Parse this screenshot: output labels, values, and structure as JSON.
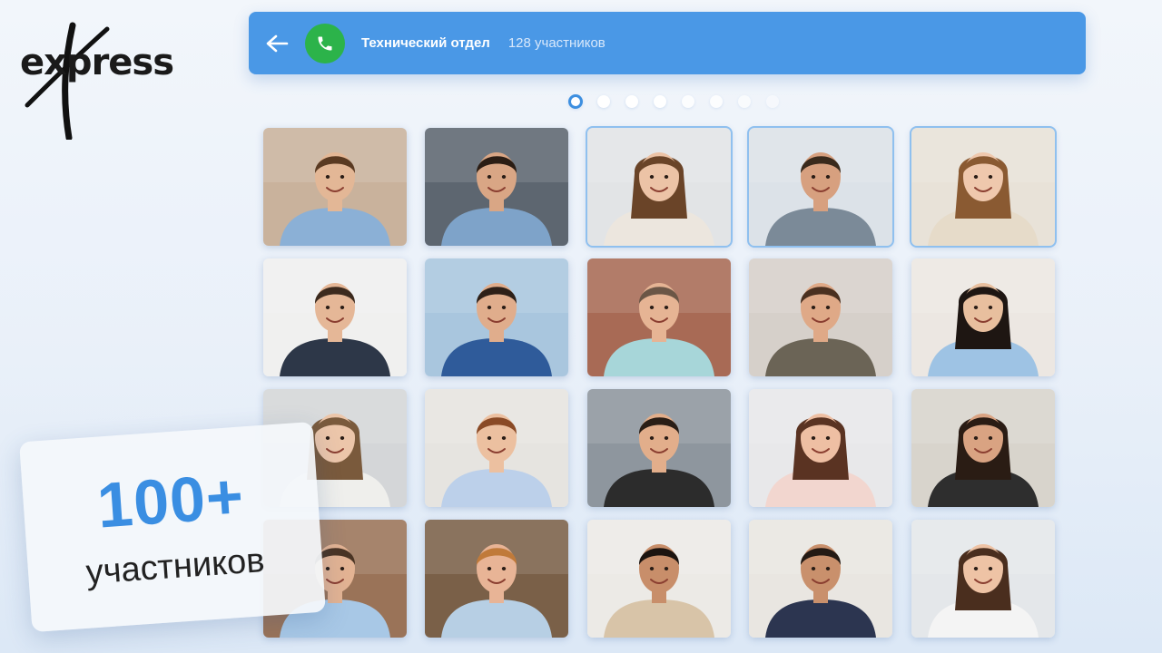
{
  "app": {
    "logo_text": "express"
  },
  "header": {
    "back_icon": "arrow-left-icon",
    "call_icon": "phone-icon",
    "title": "Технический отдел",
    "participants": "128 участников",
    "colors": {
      "bar": "#4a98e6",
      "call": "#2cb34a"
    }
  },
  "pagination": {
    "pages": 8,
    "current": 1
  },
  "participants_grid": {
    "tiles": [
      {
        "bg": "#c9b29c",
        "skin": "#e3b796",
        "hair": "#5a3a22",
        "shirt": "#8bb0d6"
      },
      {
        "bg": "#5d6670",
        "skin": "#d9a685",
        "hair": "#2b1d14",
        "shirt": "#7ea3c9"
      },
      {
        "bg": "#e2e4e6",
        "skin": "#ecc3a6",
        "hair": "#6a4428",
        "shirt": "#ece6de"
      },
      {
        "bg": "#dce2e8",
        "skin": "#d7a07f",
        "hair": "#3a2a1c",
        "shirt": "#7b8a98"
      },
      {
        "bg": "#e8e2d8",
        "skin": "#efc8ad",
        "hair": "#8a5a32",
        "shirt": "#e6dbc9"
      },
      {
        "bg": "#f0f0ef",
        "skin": "#e5b797",
        "hair": "#3c2a1e",
        "shirt": "#2d3748"
      },
      {
        "bg": "#a9c6de",
        "skin": "#e0ad8c",
        "hair": "#2e2018",
        "shirt": "#2f5b9a"
      },
      {
        "bg": "#a86a55",
        "skin": "#e6b494",
        "hair": "#6b5646",
        "shirt": "#a7d6d9"
      },
      {
        "bg": "#d6d0ca",
        "skin": "#dfa987",
        "hair": "#4a3020",
        "shirt": "#6b6456"
      },
      {
        "bg": "#ece7e2",
        "skin": "#e8bf9e",
        "hair": "#1e1612",
        "shirt": "#9ec3e4"
      },
      {
        "bg": "#d4d6d8",
        "skin": "#ecc6aa",
        "hair": "#7a5a3c",
        "shirt": "#efefec"
      },
      {
        "bg": "#e6e4e0",
        "skin": "#ecc0a0",
        "hair": "#8a4a26",
        "shirt": "#bcd0ea"
      },
      {
        "bg": "#8e969e",
        "skin": "#e2ae8b",
        "hair": "#2a1e16",
        "shirt": "#2c2c2c"
      },
      {
        "bg": "#e8e8ea",
        "skin": "#eebfa3",
        "hair": "#5a3322",
        "shirt": "#f2d6cf"
      },
      {
        "bg": "#d8d4cc",
        "skin": "#d9a382",
        "hair": "#2a1c14",
        "shirt": "#2e2e2e"
      },
      {
        "bg": "#9a7358",
        "skin": "#e3b393",
        "hair": "#4a3424",
        "shirt": "#a8c8e6"
      },
      {
        "bg": "#7a6048",
        "skin": "#e8b496",
        "hair": "#c07a3a",
        "shirt": "#b7cfe4"
      },
      {
        "bg": "#eceae6",
        "skin": "#c88e6a",
        "hair": "#1c1410",
        "shirt": "#d8c4a8"
      },
      {
        "bg": "#e9e6e1",
        "skin": "#c9906c",
        "hair": "#241a14",
        "shirt": "#2c3550"
      },
      {
        "bg": "#e4e7ea",
        "skin": "#eec3a5",
        "hair": "#4a2e1e",
        "shirt": "#f4f4f4"
      }
    ]
  },
  "promo": {
    "number": "100+",
    "label": "участников",
    "accent": "#3a8ee2"
  }
}
